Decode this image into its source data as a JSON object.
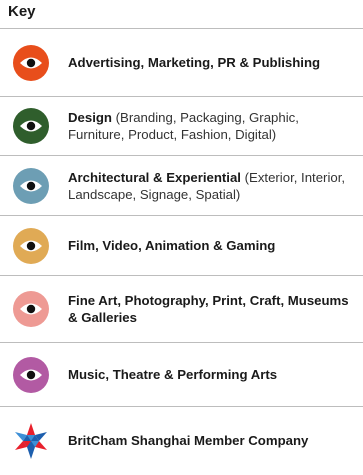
{
  "key": {
    "title": "Key",
    "items": [
      {
        "icon": "eye-icon",
        "color": "#e84e1b",
        "label_bold": "Advertising, Marketing, PR & Publishing",
        "label_light": ""
      },
      {
        "icon": "eye-icon",
        "color": "#2f5e2c",
        "label_bold": "Design",
        "label_light": " (Branding, Packaging, Graphic, Furniture, Product, Fashion, Digital)"
      },
      {
        "icon": "eye-icon",
        "color": "#6d9eb4",
        "label_bold": "Architectural & Experiential",
        "label_light": " (Exterior, Interior, Landscape, Signage, Spatial)"
      },
      {
        "icon": "eye-icon",
        "color": "#e0aa55",
        "label_bold": "Film, Video, Animation & Gaming",
        "label_light": ""
      },
      {
        "icon": "eye-icon",
        "color": "#ee9a94",
        "label_bold": "Fine Art, Photography, Print, Craft, Museums & Galleries",
        "label_light": ""
      },
      {
        "icon": "eye-icon",
        "color": "#b25aa3",
        "label_bold": "Music, Theatre & Performing Arts",
        "label_light": ""
      },
      {
        "icon": "star-icon",
        "colors": [
          "#1d5fae",
          "#e8202c",
          "#3d8fd6"
        ],
        "label_bold": "BritCham Shanghai Member Company",
        "label_light": ""
      }
    ]
  }
}
